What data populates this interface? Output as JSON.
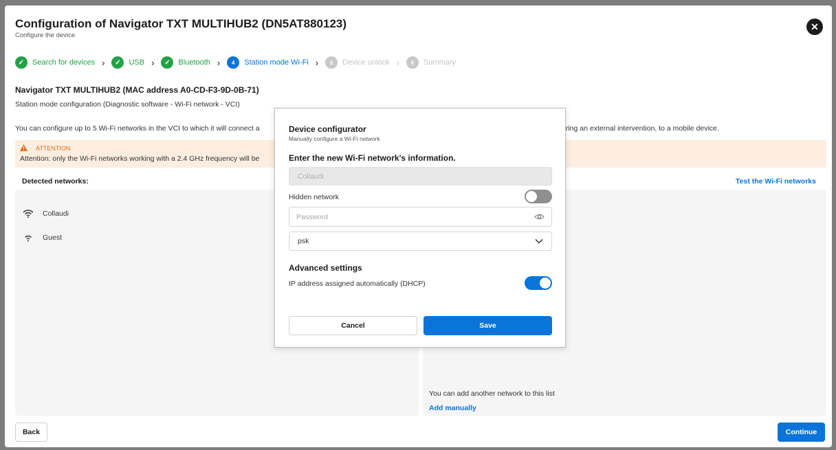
{
  "header": {
    "title": "Configuration of Navigator TXT MULTIHUB2 (DN5AT880123)",
    "subtitle": "Configure the device",
    "close_icon": "close-icon"
  },
  "stepper": {
    "steps": [
      {
        "number": "✓",
        "label": "Search for devices",
        "state": "done"
      },
      {
        "number": "✓",
        "label": "USB",
        "state": "done"
      },
      {
        "number": "✓",
        "label": "Bluetooth",
        "state": "done"
      },
      {
        "number": "4",
        "label": "Station mode Wi-Fi",
        "state": "active"
      },
      {
        "number": "5",
        "label": "Device unlock",
        "state": "todo"
      },
      {
        "number": "6",
        "label": "Summary",
        "state": "todo"
      }
    ],
    "separator": "›"
  },
  "main": {
    "device_heading": "Navigator TXT MULTIHUB2 (MAC address A0-CD-F3-9D-0B-71)",
    "config_desc": "Station mode configuration (Diagnostic software - Wi-Fi network - VCI)",
    "info_text": "You can configure up to 5 Wi-Fi networks in the VCI to which it will connect a",
    "info_text_tail": "uring an external intervention, to a mobile device.",
    "attention_title": "ATTENTION",
    "attention_body": "Attention: only the Wi-Fi networks working with a 2.4 GHz frequency will be",
    "detected_label": "Detected networks:",
    "test_link": "Test the Wi-Fi networks",
    "networks": [
      {
        "name": "Collaudi",
        "icon": "wifi-icon"
      },
      {
        "name": "Guest",
        "icon": "wifi-icon"
      }
    ],
    "add_text": "You can add another network to this list",
    "add_link": "Add manually"
  },
  "footer": {
    "back_label": "Back",
    "continue_label": "Continue"
  },
  "modal": {
    "title": "Device configurator",
    "subtitle": "Manually configure a Wi-Fi network",
    "prompt": "Enter the new Wi-Fi network's information.",
    "ssid_value": "Collaudi",
    "hidden_label": "Hidden network",
    "hidden_enabled": false,
    "password_placeholder": "Password",
    "security_value": "psk",
    "advanced_heading": "Advanced settings",
    "dhcp_label": "IP address assigned automatically (DHCP)",
    "dhcp_enabled": true,
    "cancel_label": "Cancel",
    "save_label": "Save"
  },
  "colors": {
    "accent": "#0a74da",
    "success": "#24a148",
    "warning": "#e0701b",
    "warning_bg": "#fdeee1"
  }
}
